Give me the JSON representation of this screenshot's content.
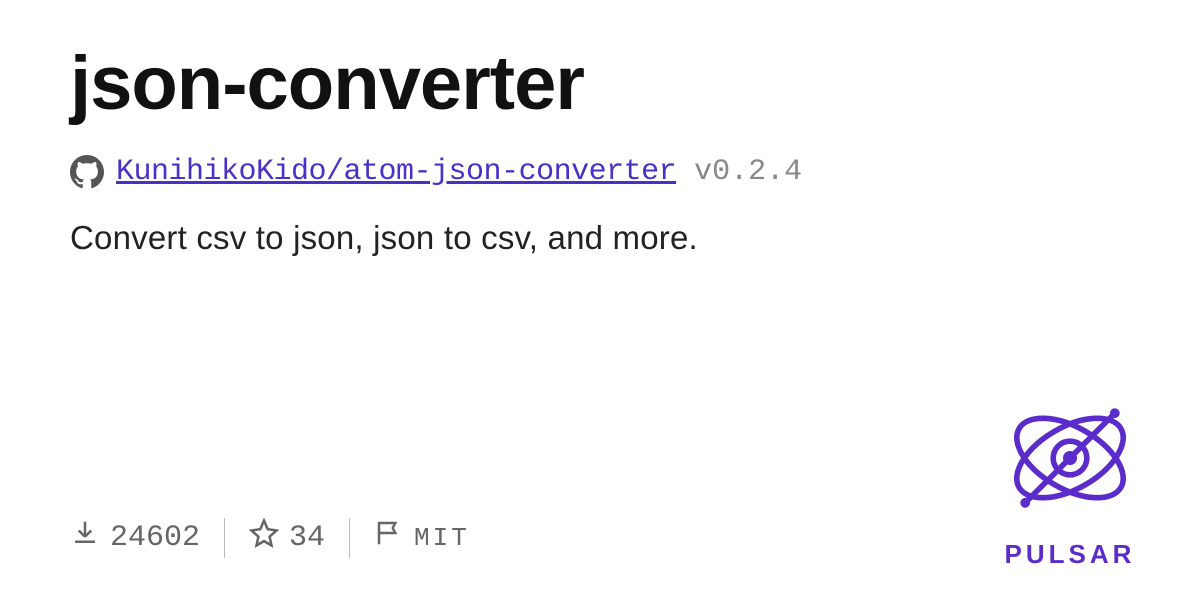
{
  "package": {
    "name": "json-converter",
    "repo": "KunihikoKido/atom-json-converter",
    "version": "v0.2.4",
    "description": "Convert csv to json, json to csv, and more."
  },
  "stats": {
    "downloads": "24602",
    "stars": "34",
    "license": "MIT"
  },
  "brand": {
    "name": "PULSAR"
  }
}
